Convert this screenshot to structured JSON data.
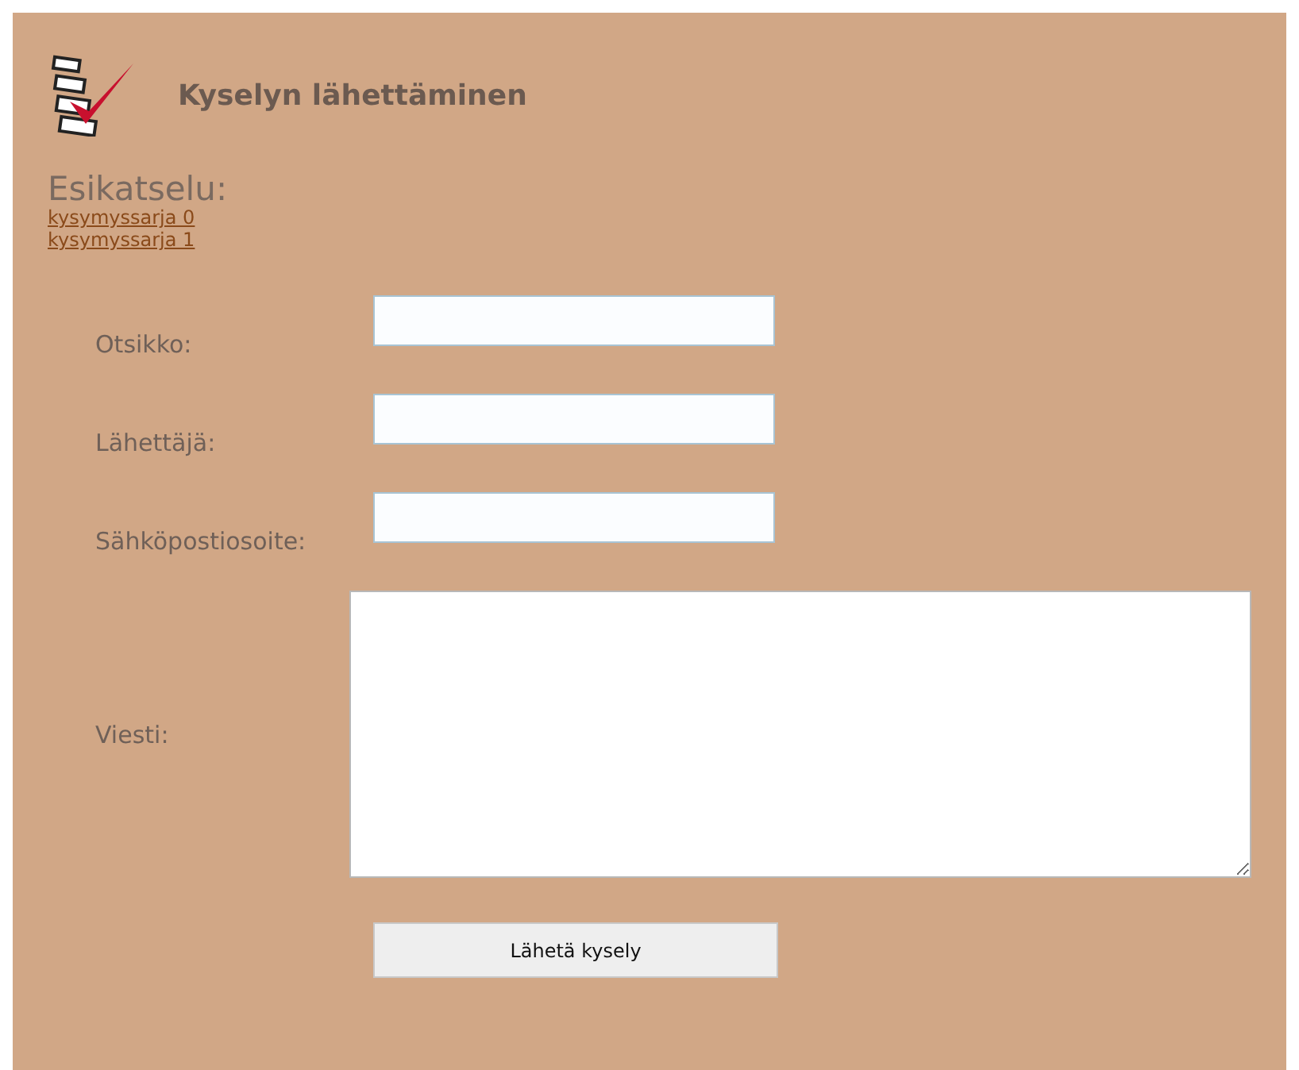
{
  "header": {
    "title": "Kyselyn lähettäminen"
  },
  "preview": {
    "title": "Esikatselu:",
    "links": [
      "kysymyssarja 0",
      "kysymyssarja 1"
    ]
  },
  "form": {
    "fields": [
      {
        "kind": "input",
        "label": "Otsikko:"
      },
      {
        "kind": "input",
        "label": "Lähettäjä:"
      },
      {
        "kind": "input",
        "label": "Sähköpostiosoite:"
      },
      {
        "kind": "textarea",
        "label": "Viesti:"
      }
    ],
    "submit": "Lähetä kysely"
  }
}
